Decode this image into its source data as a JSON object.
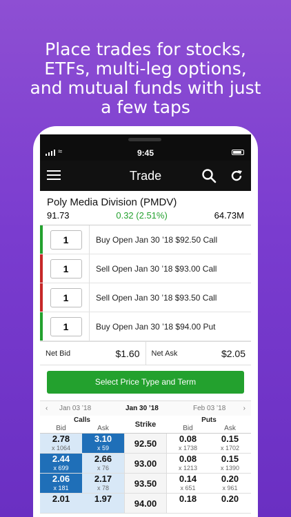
{
  "headline": [
    "Place trades for stocks,",
    "ETFs, multi-leg options,",
    "and mutual funds with just",
    "a few taps"
  ],
  "status": {
    "time": "9:45"
  },
  "nav": {
    "title": "Trade"
  },
  "quote": {
    "name": "Poly Media Division (PMDV)",
    "price": "91.73",
    "change": "0.32 (2.51%)",
    "volume": "64.73M"
  },
  "legs": [
    {
      "qty": "1",
      "text": "Buy Open Jan 30 ’18 $92.50 Call",
      "color": "#23a12e"
    },
    {
      "qty": "1",
      "text": "Sell Open Jan 30 ’18 $93.00 Call",
      "color": "#c62828"
    },
    {
      "qty": "1",
      "text": "Sell Open Jan 30 ’18 $93.50 Call",
      "color": "#c62828"
    },
    {
      "qty": "1",
      "text": "Buy Open Jan 30 ’18 $94.00 Put",
      "color": "#23a12e"
    }
  ],
  "net": {
    "bid_label": "Net Bid",
    "bid": "$1.60",
    "ask_label": "Net Ask",
    "ask": "$2.05"
  },
  "select_button": "Select Price Type and Term",
  "dates": {
    "prev": "Jan 03 ’18",
    "current": "Jan 30 ’18",
    "next": "Feb 03 ’18"
  },
  "chain_header": {
    "calls": "Calls",
    "puts": "Puts",
    "strike": "Strike",
    "bid": "Bid",
    "ask": "Ask"
  },
  "chain": [
    {
      "cb": "2.78",
      "cbs": "x 1064",
      "ca": "3.10",
      "cas": "x 59",
      "strike": "92.50",
      "pb": "0.08",
      "pbs": "x 1738",
      "pa": "0.15",
      "pas": "x 1702"
    },
    {
      "cb": "2.44",
      "cbs": "x 699",
      "ca": "2.66",
      "cas": "x 76",
      "strike": "93.00",
      "pb": "0.08",
      "pbs": "x 1213",
      "pa": "0.15",
      "pas": "x 1390"
    },
    {
      "cb": "2.06",
      "cbs": "x 181",
      "ca": "2.17",
      "cas": "x 78",
      "strike": "93.50",
      "pb": "0.14",
      "pbs": "x 651",
      "pa": "0.20",
      "pas": "x 961"
    },
    {
      "cb": "2.01",
      "cbs": "",
      "ca": "1.97",
      "cas": "",
      "strike": "94.00",
      "pb": "0.18",
      "pbs": "",
      "pa": "0.20",
      "pas": ""
    }
  ]
}
